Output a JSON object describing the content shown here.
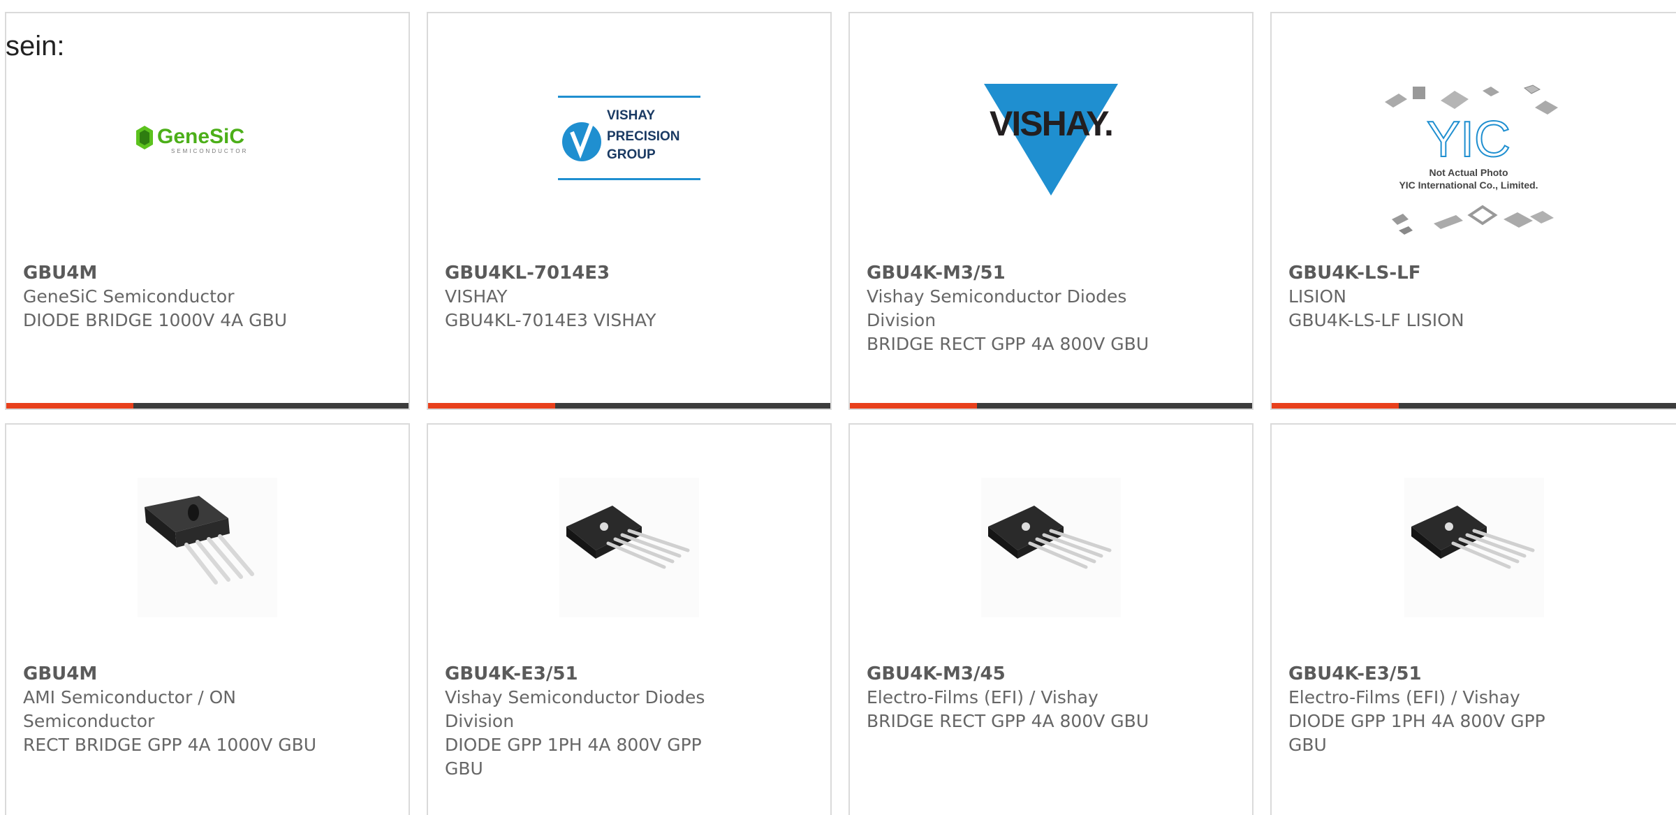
{
  "intro": "sein:",
  "colors": {
    "card_border": "#dadada",
    "bar_dark": "#3c3c3c",
    "bar_accent": "#e8401c",
    "text_gray": "#666666",
    "vishay_blue": "#1f8fd0",
    "genesic_green": "#5cc21e"
  },
  "products": [
    {
      "part": "GBU4M",
      "manufacturer": "GeneSiC Semiconductor",
      "desc": "DIODE BRIDGE 1000V 4A GBU",
      "image": "genesic-logo",
      "logo_text": "GeneSiC",
      "logo_sub": "SEMICONDUCTOR"
    },
    {
      "part": "GBU4KL-7014E3",
      "manufacturer": "VISHAY",
      "desc": "GBU4KL-7014E3 VISHAY",
      "image": "vishay-precision-logo",
      "logo_lines": [
        "VISHAY",
        "PRECISION",
        "GROUP"
      ]
    },
    {
      "part": "GBU4K-M3/51",
      "manufacturer": "Vishay Semiconductor Diodes Division",
      "desc": "BRIDGE RECT GPP 4A 800V GBU",
      "image": "vishay-logo",
      "logo_text": "VISHAY."
    },
    {
      "part": "GBU4K-LS-LF",
      "manufacturer": "LISION",
      "desc": "GBU4K-LS-LF LISION",
      "image": "yic-placeholder",
      "logo_text": "YIC",
      "caption_1": "Not Actual Photo",
      "caption_2": "YIC International Co., Limited."
    },
    {
      "part": "GBU4M",
      "manufacturer": "AMI Semiconductor / ON Semiconductor",
      "desc": "RECT BRIDGE GPP 4A 1000V GBU",
      "image": "bridge-rectifier-photo"
    },
    {
      "part": "GBU4K-E3/51",
      "manufacturer": "Vishay Semiconductor Diodes Division",
      "desc": "DIODE GPP 1PH 4A 800V GPP GBU",
      "image": "bridge-rectifier-photo"
    },
    {
      "part": "GBU4K-M3/45",
      "manufacturer": "Electro-Films (EFI) / Vishay",
      "desc": "BRIDGE RECT GPP 4A 800V GBU",
      "image": "bridge-rectifier-photo"
    },
    {
      "part": "GBU4K-E3/51",
      "manufacturer": "Electro-Films (EFI) / Vishay",
      "desc": "DIODE GPP 1PH 4A 800V GPP GBU",
      "image": "bridge-rectifier-photo"
    }
  ]
}
